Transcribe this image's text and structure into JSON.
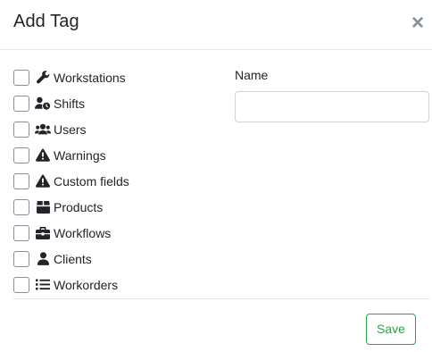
{
  "modal": {
    "title": "Add Tag",
    "close_glyph": "×"
  },
  "tags": [
    {
      "label": "Workstations",
      "icon": "wrench-icon",
      "checked": false
    },
    {
      "label": "Shifts",
      "icon": "user-clock-icon",
      "checked": false
    },
    {
      "label": "Users",
      "icon": "users-icon",
      "checked": false
    },
    {
      "label": "Warnings",
      "icon": "warning-icon",
      "checked": false
    },
    {
      "label": "Custom fields",
      "icon": "warning-icon",
      "checked": false
    },
    {
      "label": "Products",
      "icon": "box-icon",
      "checked": false
    },
    {
      "label": "Workflows",
      "icon": "briefcase-icon",
      "checked": false
    },
    {
      "label": "Clients",
      "icon": "user-icon",
      "checked": false
    },
    {
      "label": "Workorders",
      "icon": "list-icon",
      "checked": false
    }
  ],
  "form": {
    "name_label": "Name",
    "name_value": "",
    "name_placeholder": ""
  },
  "footer": {
    "save_label": "Save"
  },
  "colors": {
    "save_accent": "#28a745",
    "icon": "#212529",
    "border": "#ced4da"
  }
}
